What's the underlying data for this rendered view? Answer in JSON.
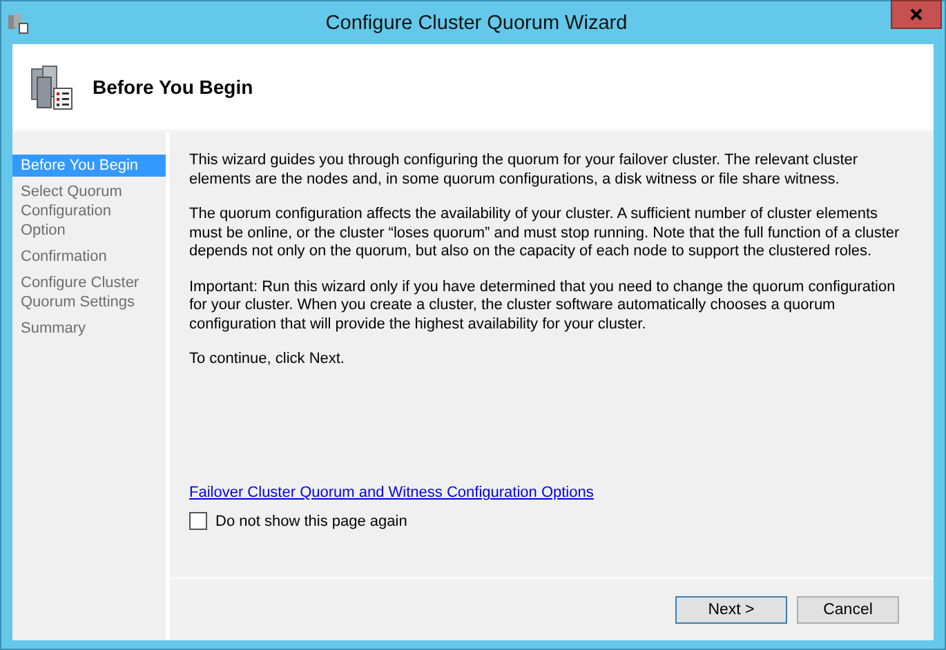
{
  "window": {
    "title": "Configure Cluster Quorum Wizard"
  },
  "header": {
    "title": "Before You Begin"
  },
  "steps": [
    {
      "label": "Before You Begin",
      "selected": true
    },
    {
      "label": "Select Quorum Configuration Option",
      "selected": false
    },
    {
      "label": "Confirmation",
      "selected": false
    },
    {
      "label": "Configure Cluster Quorum Settings",
      "selected": false
    },
    {
      "label": "Summary",
      "selected": false
    }
  ],
  "paragraphs": [
    "This wizard guides you through configuring the quorum for your failover cluster. The relevant cluster elements are the nodes and, in some quorum configurations, a disk witness or file share witness.",
    "The quorum configuration affects the availability of your cluster. A sufficient number of cluster elements must be online, or the cluster “loses quorum” and must stop running. Note that the full function of a cluster depends not only on the quorum, but also on the capacity of each node to support the clustered roles.",
    "Important: Run this wizard only if you have determined that you need to change the quorum configuration for your cluster. When you create a cluster, the cluster software automatically chooses a quorum configuration that will provide the highest availability for your cluster.",
    "To continue, click Next."
  ],
  "link": "Failover Cluster Quorum and Witness Configuration Options",
  "checkbox": {
    "label": "Do not show this page again",
    "checked": false
  },
  "buttons": [
    {
      "label": "Next >",
      "kind": "default"
    },
    {
      "label": "Cancel",
      "kind": "normal"
    }
  ]
}
